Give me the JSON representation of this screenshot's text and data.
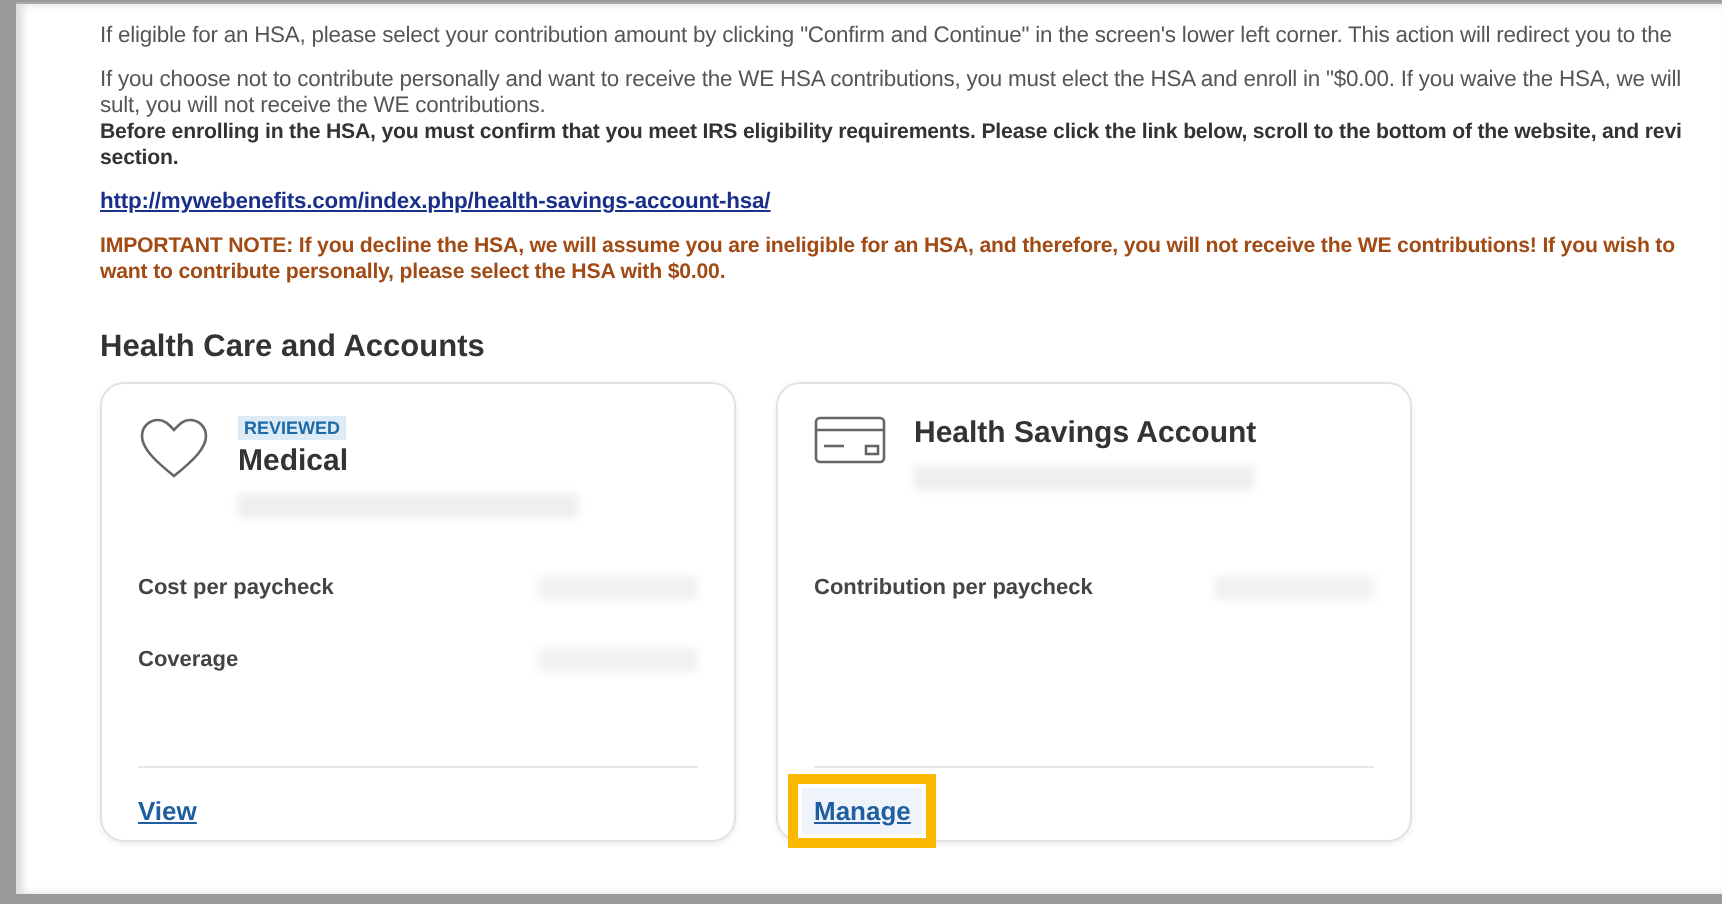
{
  "intro_paragraphs": [
    {
      "kind": "plain",
      "lines": [
        "If eligible for an HSA, please select your contribution amount by clicking \"Confirm and Continue\" in the screen's lower left corner. This action will redirect you to the"
      ]
    },
    {
      "kind": "plain",
      "lines": [
        "If you choose not to contribute personally and want to receive the WE HSA contributions, you must elect the HSA and enroll in \"$0.00. If you waive the HSA, we will",
        "sult, you will not receive the WE contributions."
      ]
    },
    {
      "kind": "bold",
      "lines": [
        "Before enrolling in the HSA, you must confirm that you meet IRS eligibility requirements. Please click the link below, scroll to the bottom of the website, and revi",
        "section."
      ]
    },
    {
      "kind": "link",
      "lines": [
        "http://mywebenefits.com/index.php/health-savings-account-hsa/"
      ]
    },
    {
      "kind": "warning",
      "lines": [
        "IMPORTANT NOTE:  If you decline the HSA, we will assume you are ineligible for an HSA, and therefore, you will not receive the WE contributions! If you wish to",
        "want to contribute personally, please select the HSA with $0.00."
      ]
    }
  ],
  "section_title": "Health Care and Accounts",
  "cards": [
    {
      "badge": "REVIEWED",
      "title": "Medical",
      "fields": [
        "Cost per paycheck",
        "Coverage"
      ],
      "action": "View",
      "highlighted": false
    },
    {
      "title": "Health Savings Account",
      "fields": [
        "Contribution per paycheck"
      ],
      "action": "Manage",
      "highlighted": true
    }
  ]
}
